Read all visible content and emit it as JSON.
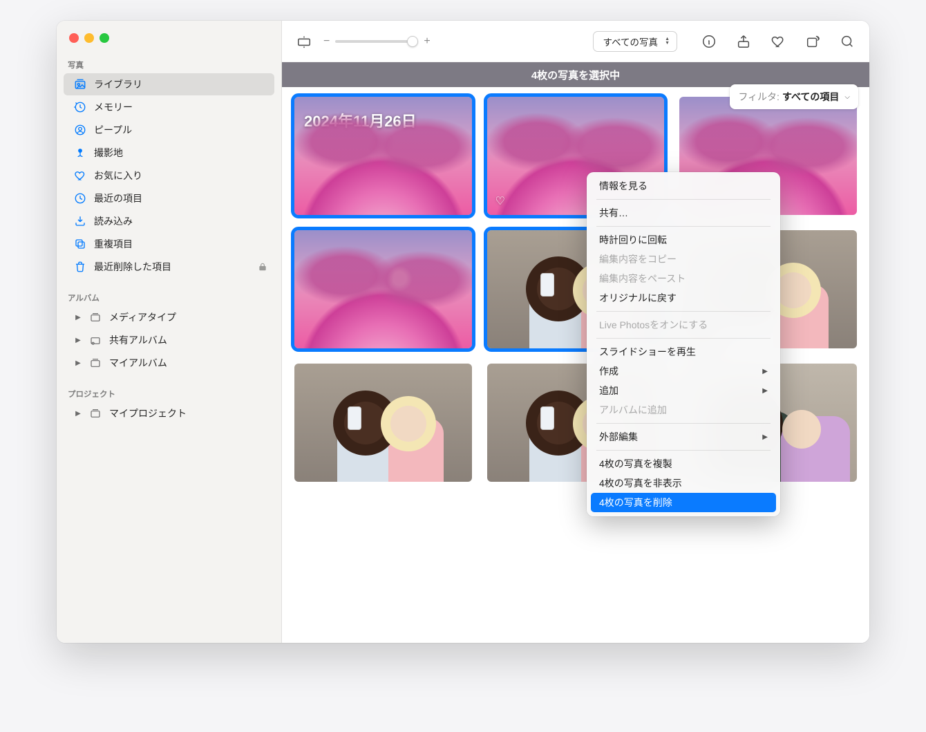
{
  "sidebar": {
    "sections": {
      "photos_label": "写真",
      "albums_label": "アルバム",
      "projects_label": "プロジェクト"
    },
    "items": {
      "library": "ライブラリ",
      "memories": "メモリー",
      "people": "ピープル",
      "places": "撮影地",
      "favorites": "お気に入り",
      "recents": "最近の項目",
      "imports": "読み込み",
      "duplicates": "重複項目",
      "recently_deleted": "最近削除した項目",
      "media_types": "メディアタイプ",
      "shared_albums": "共有アルバム",
      "my_albums": "マイアルバム",
      "my_projects": "マイプロジェクト"
    }
  },
  "toolbar": {
    "view_popup": "すべての写真",
    "zoom_minus": "−",
    "zoom_plus": "+"
  },
  "header": {
    "selection_status": "4枚の写真を選択中",
    "date_overlay": "2024年11月26日",
    "filter_label": "フィルタ:",
    "filter_value": "すべての項目"
  },
  "context_menu": {
    "get_info": "情報を見る",
    "share": "共有…",
    "rotate_cw": "時計回りに回転",
    "copy_edits": "編集内容をコピー",
    "paste_edits": "編集内容をペースト",
    "revert": "オリジナルに戻す",
    "live_photos_on": "Live Photosをオンにする",
    "play_slideshow": "スライドショーを再生",
    "create": "作成",
    "add_to": "追加",
    "add_to_album": "アルバムに追加",
    "edit_with": "外部編集",
    "duplicate_n": "4枚の写真を複製",
    "hide_n": "4枚の写真を非表示",
    "delete_n": "4枚の写真を削除"
  }
}
